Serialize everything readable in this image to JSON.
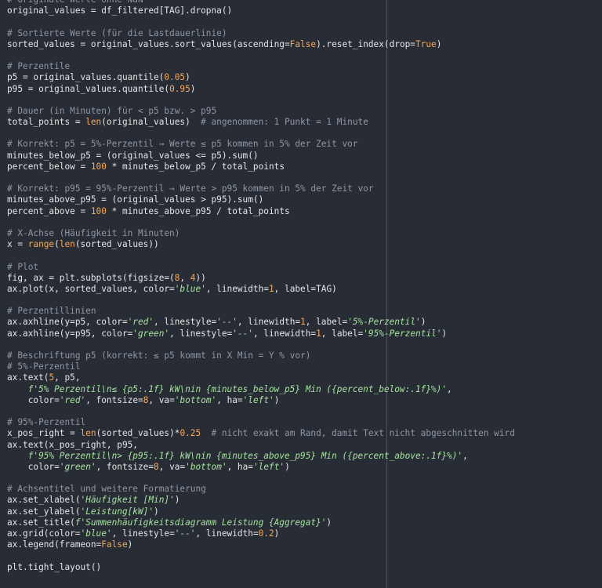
{
  "colors": {
    "background": "#282c34",
    "text": "#e6e6e6",
    "comment": "#8f97a5",
    "string": "#a6e3a1",
    "number_builtin": "#f6a95a",
    "ruler": "#4a505b"
  },
  "code_lines": [
    [
      {
        "t": "comment",
        "s": "# Originale Werte ohne NaN"
      }
    ],
    [
      {
        "t": "plain",
        "s": "original_values = df_filtered[TAG].dropna()"
      }
    ],
    [],
    [
      {
        "t": "comment",
        "s": "# Sortierte Werte (für die Lastdauerlinie)"
      }
    ],
    [
      {
        "t": "plain",
        "s": "sorted_values = original_values.sort_values(ascending="
      },
      {
        "t": "const",
        "s": "False"
      },
      {
        "t": "plain",
        "s": ").reset_index(drop="
      },
      {
        "t": "const",
        "s": "True"
      },
      {
        "t": "plain",
        "s": ")"
      }
    ],
    [],
    [
      {
        "t": "comment",
        "s": "# Perzentile"
      }
    ],
    [
      {
        "t": "plain",
        "s": "p5 = original_values.quantile("
      },
      {
        "t": "num",
        "s": "0.05"
      },
      {
        "t": "plain",
        "s": ")"
      }
    ],
    [
      {
        "t": "plain",
        "s": "p95 = original_values.quantile("
      },
      {
        "t": "num",
        "s": "0.95"
      },
      {
        "t": "plain",
        "s": ")"
      }
    ],
    [],
    [
      {
        "t": "comment",
        "s": "# Dauer (in Minuten) für < p5 bzw. > p95"
      }
    ],
    [
      {
        "t": "plain",
        "s": "total_points = "
      },
      {
        "t": "builtin",
        "s": "len"
      },
      {
        "t": "plain",
        "s": "(original_values)  "
      },
      {
        "t": "comment",
        "s": "# angenommen: 1 Punkt = 1 Minute"
      }
    ],
    [],
    [
      {
        "t": "comment",
        "s": "# Korrekt: p5 = 5%-Perzentil → Werte ≤ p5 kommen in 5% der Zeit vor"
      }
    ],
    [
      {
        "t": "plain",
        "s": "minutes_below_p5 = (original_values <= p5).sum()"
      }
    ],
    [
      {
        "t": "plain",
        "s": "percent_below = "
      },
      {
        "t": "num",
        "s": "100"
      },
      {
        "t": "plain",
        "s": " * minutes_below_p5 / total_points"
      }
    ],
    [],
    [
      {
        "t": "comment",
        "s": "# Korrekt: p95 = 95%-Perzentil → Werte > p95 kommen in 5% der Zeit vor"
      }
    ],
    [
      {
        "t": "plain",
        "s": "minutes_above_p95 = (original_values > p95).sum()"
      }
    ],
    [
      {
        "t": "plain",
        "s": "percent_above = "
      },
      {
        "t": "num",
        "s": "100"
      },
      {
        "t": "plain",
        "s": " * minutes_above_p95 / total_points"
      }
    ],
    [],
    [
      {
        "t": "comment",
        "s": "# X-Achse (Häufigkeit in Minuten)"
      }
    ],
    [
      {
        "t": "plain",
        "s": "x = "
      },
      {
        "t": "builtin",
        "s": "range"
      },
      {
        "t": "plain",
        "s": "("
      },
      {
        "t": "builtin",
        "s": "len"
      },
      {
        "t": "plain",
        "s": "(sorted_values))"
      }
    ],
    [],
    [
      {
        "t": "comment",
        "s": "# Plot"
      }
    ],
    [
      {
        "t": "plain",
        "s": "fig, ax = plt.subplots(figsize=("
      },
      {
        "t": "num",
        "s": "8"
      },
      {
        "t": "plain",
        "s": ", "
      },
      {
        "t": "num",
        "s": "4"
      },
      {
        "t": "plain",
        "s": "))"
      }
    ],
    [
      {
        "t": "plain",
        "s": "ax.plot(x, sorted_values, color="
      },
      {
        "t": "string",
        "s": "'blue'"
      },
      {
        "t": "plain",
        "s": ", linewidth="
      },
      {
        "t": "num",
        "s": "1"
      },
      {
        "t": "plain",
        "s": ", label=TAG)"
      }
    ],
    [],
    [
      {
        "t": "comment",
        "s": "# Perzentillinien"
      }
    ],
    [
      {
        "t": "plain",
        "s": "ax.axhline(y=p5, color="
      },
      {
        "t": "string",
        "s": "'red'"
      },
      {
        "t": "plain",
        "s": ", linestyle="
      },
      {
        "t": "string",
        "s": "'--'"
      },
      {
        "t": "plain",
        "s": ", linewidth="
      },
      {
        "t": "num",
        "s": "1"
      },
      {
        "t": "plain",
        "s": ", label="
      },
      {
        "t": "string",
        "s": "'5%-Perzentil'"
      },
      {
        "t": "plain",
        "s": ")"
      }
    ],
    [
      {
        "t": "plain",
        "s": "ax.axhline(y=p95, color="
      },
      {
        "t": "string",
        "s": "'green'"
      },
      {
        "t": "plain",
        "s": ", linestyle="
      },
      {
        "t": "string",
        "s": "'--'"
      },
      {
        "t": "plain",
        "s": ", linewidth="
      },
      {
        "t": "num",
        "s": "1"
      },
      {
        "t": "plain",
        "s": ", label="
      },
      {
        "t": "string",
        "s": "'95%-Perzentil'"
      },
      {
        "t": "plain",
        "s": ")"
      }
    ],
    [],
    [
      {
        "t": "comment",
        "s": "# Beschriftung p5 (korrekt: ≤ p5 kommt in X Min = Y % vor)"
      }
    ],
    [
      {
        "t": "comment",
        "s": "# 5%-Perzentil"
      }
    ],
    [
      {
        "t": "plain",
        "s": "ax.text("
      },
      {
        "t": "num",
        "s": "5"
      },
      {
        "t": "plain",
        "s": ", p5,"
      }
    ],
    [
      {
        "t": "plain",
        "s": "    "
      },
      {
        "t": "string",
        "s": "f'5% Perzentil\\n≤ {p5:.1f} kW\\nin {minutes_below_p5} Min ({percent_below:.1f}%)'"
      },
      {
        "t": "plain",
        "s": ","
      }
    ],
    [
      {
        "t": "plain",
        "s": "    color="
      },
      {
        "t": "string",
        "s": "'red'"
      },
      {
        "t": "plain",
        "s": ", fontsize="
      },
      {
        "t": "num",
        "s": "8"
      },
      {
        "t": "plain",
        "s": ", va="
      },
      {
        "t": "string",
        "s": "'bottom'"
      },
      {
        "t": "plain",
        "s": ", ha="
      },
      {
        "t": "string",
        "s": "'left'"
      },
      {
        "t": "plain",
        "s": ")"
      }
    ],
    [],
    [
      {
        "t": "comment",
        "s": "# 95%-Perzentil"
      }
    ],
    [
      {
        "t": "plain",
        "s": "x_pos_right = "
      },
      {
        "t": "builtin",
        "s": "len"
      },
      {
        "t": "plain",
        "s": "(sorted_values)*"
      },
      {
        "t": "num",
        "s": "0.25"
      },
      {
        "t": "plain",
        "s": "  "
      },
      {
        "t": "comment",
        "s": "# nicht exakt am Rand, damit Text nicht abgeschnitten wird"
      }
    ],
    [
      {
        "t": "plain",
        "s": "ax.text(x_pos_right, p95,"
      }
    ],
    [
      {
        "t": "plain",
        "s": "    "
      },
      {
        "t": "string",
        "s": "f'95% Perzentil\\n> {p95:.1f} kW\\nin {minutes_above_p95} Min ({percent_above:.1f}%)'"
      },
      {
        "t": "plain",
        "s": ","
      }
    ],
    [
      {
        "t": "plain",
        "s": "    color="
      },
      {
        "t": "string",
        "s": "'green'"
      },
      {
        "t": "plain",
        "s": ", fontsize="
      },
      {
        "t": "num",
        "s": "8"
      },
      {
        "t": "plain",
        "s": ", va="
      },
      {
        "t": "string",
        "s": "'bottom'"
      },
      {
        "t": "plain",
        "s": ", ha="
      },
      {
        "t": "string",
        "s": "'left'"
      },
      {
        "t": "plain",
        "s": ")"
      }
    ],
    [],
    [
      {
        "t": "comment",
        "s": "# Achsentitel und weitere Formatierung"
      }
    ],
    [
      {
        "t": "plain",
        "s": "ax.set_xlabel("
      },
      {
        "t": "string",
        "s": "'Häufigkeit [Min]'"
      },
      {
        "t": "plain",
        "s": ")"
      }
    ],
    [
      {
        "t": "plain",
        "s": "ax.set_ylabel("
      },
      {
        "t": "string",
        "s": "'Leistung[kW]'"
      },
      {
        "t": "plain",
        "s": ")"
      }
    ],
    [
      {
        "t": "plain",
        "s": "ax.set_title("
      },
      {
        "t": "string",
        "s": "f'Summenhäufigkeitsdiagramm Leistung {Aggregat}'"
      },
      {
        "t": "plain",
        "s": ")"
      }
    ],
    [
      {
        "t": "plain",
        "s": "ax.grid(color="
      },
      {
        "t": "string",
        "s": "'blue'"
      },
      {
        "t": "plain",
        "s": ", linestyle="
      },
      {
        "t": "string",
        "s": "'--'"
      },
      {
        "t": "plain",
        "s": ", linewidth="
      },
      {
        "t": "num",
        "s": "0.2"
      },
      {
        "t": "plain",
        "s": ")"
      }
    ],
    [
      {
        "t": "plain",
        "s": "ax.legend(frameon="
      },
      {
        "t": "const",
        "s": "False"
      },
      {
        "t": "plain",
        "s": ")"
      }
    ],
    [],
    [
      {
        "t": "plain",
        "s": "plt.tight_layout()"
      }
    ]
  ]
}
